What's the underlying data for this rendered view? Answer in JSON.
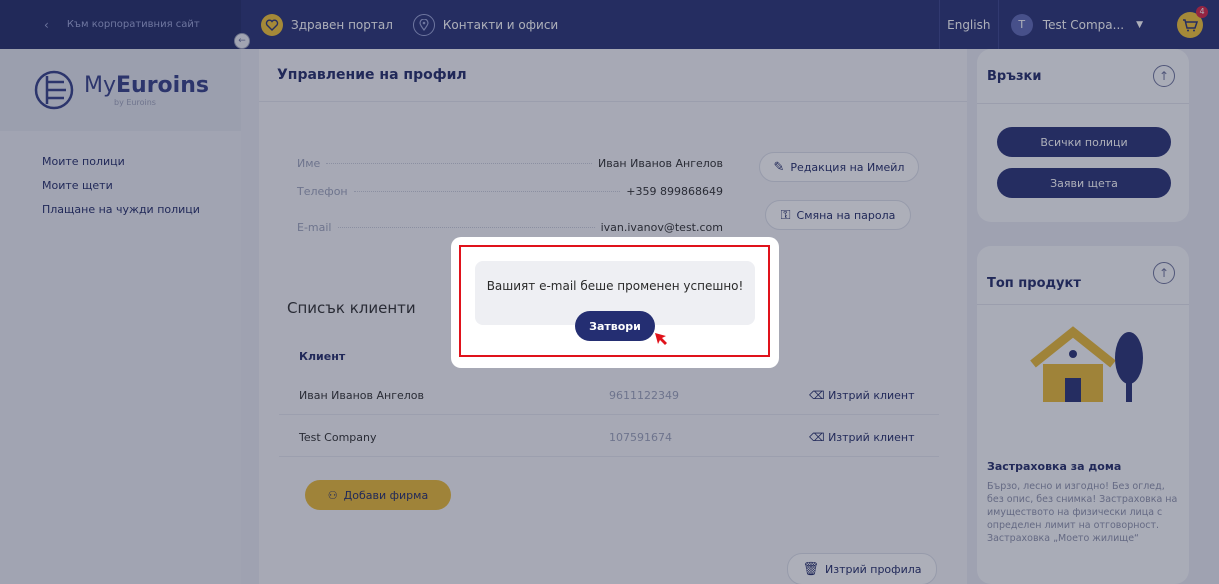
{
  "topbar": {
    "corp_link": "Към корпоративния сайт",
    "health_portal": "Здравен портал",
    "contacts": "Контакти и офиси",
    "language": "English",
    "avatar_letter": "T",
    "user_name": "Test Compa...",
    "cart_count": "4"
  },
  "sidebar": {
    "logo_main": "My",
    "logo_bold": "Euroins",
    "logo_sub": "by Euroins",
    "items": [
      "Моите полици",
      "Моите щети",
      "Плащане на чужди полици"
    ]
  },
  "profile": {
    "title": "Управление на профил",
    "rows": [
      {
        "label": "Име",
        "value": "Иван Иванов Ангелов"
      },
      {
        "label": "Телефон",
        "value": "+359 899868649"
      },
      {
        "label": "E-mail",
        "value": "ivan.ivanov@test.com"
      }
    ],
    "edit_email": "Редакция на Имейл",
    "change_password": "Смяна на парола"
  },
  "clients": {
    "title": "Списък клиенти",
    "column_client": "Клиент",
    "rows": [
      {
        "name": "Иван Иванов Ангелов",
        "id": "9611122349",
        "action": "Изтрий клиент"
      },
      {
        "name": "Test Company",
        "id": "107591674",
        "action": "Изтрий клиент"
      }
    ],
    "add_company": "Добави фирма",
    "delete_profile": "Изтрий профила"
  },
  "links": {
    "title": "Връзки",
    "all_policies": "Всички полици",
    "claim": "Заяви щета"
  },
  "top_product": {
    "title": "Топ продукт",
    "name": "Застраховка за дома",
    "desc": "Бързо, лесно и изгодно! Без оглед, без опис, без снимка! Застраховка на имуществото на физически лица с определен лимит на отговорност. Застраховка „Моето жилище“"
  },
  "modal": {
    "message": "Вашият e-mail беше променен успешно!",
    "close": "Затвори"
  },
  "colors": {
    "navy": "#242e72",
    "yellow": "#f2c230",
    "highlight": "#e0121b"
  }
}
